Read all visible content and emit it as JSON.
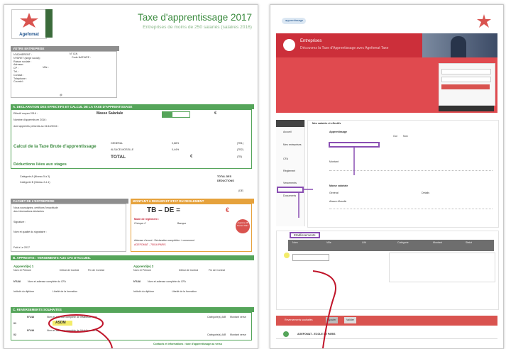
{
  "left": {
    "logo_text": "Agefomat",
    "title": "Taxe d'apprentissage 2017",
    "subtitle": "Entreprises de moins de 250 salariés (salaires 2016)",
    "sec_entreprise": "VOTRE ENTREPRISE",
    "sec_entreprise_fields": [
      "N°ADHERENT :",
      "N°SIRET (siège social) :",
      "Raison sociale :",
      "Adresse :",
      "CP :",
      "Tél. :",
      "Contact :",
      "Téléphone :",
      "Courriel :"
    ],
    "sec_entreprise_side": [
      "N° ICN",
      "Code NAF/APE :",
      "Ville :",
      "@"
    ],
    "sec_a": "A. DECLARATION DES EFFECTIFS ET CALCUL DE LA TAXE D'APPRENTISSAGE",
    "sec_a_lines": [
      "Effectif moyen 2016 :",
      "Nombre d'apprentis en 2016 :",
      "dont apprentis présents au 31/12/2016 :"
    ],
    "masse_label": "Masse Salariale",
    "taxe_brute_label": "Calcul de la Taxe Brute d'apprentissage",
    "taxe_rows": [
      "GENERAL",
      "ALSACE-MOSELLE"
    ],
    "taxe_rates": [
      "0,68%",
      "0,44%"
    ],
    "taxe_codes": [
      "(TB1)",
      "(TB2)",
      "(TB)"
    ],
    "total_label": "TOTAL",
    "euro": "€",
    "deductions_label": "Déductions liées aux stages",
    "deductions_lines": [
      "Catégorie A (Niveau 5 à 3)",
      "Catégorie B (Niveau 2 à 1)"
    ],
    "deductions_side": [
      "TOTAL DES",
      "DÉDUCTIONS"
    ],
    "deductions_code": "(DE)",
    "cachet_label": "CACHET DE L'ENTREPRISE",
    "cachet_lines": [
      "Nous soussignés, certifions l'exactitude",
      "des informations déclarées",
      "Signature :",
      "Nom et qualité du signataire :"
    ],
    "cachet_date": "Fait à          Le          2017",
    "montant_label": "MONTANT A REGLER ET ETAT DU REGLEMENT",
    "tb_de": "TB – DE =",
    "mode_label": "Mode de règlement :",
    "mode_opts": [
      "Chèque n°",
      "Banque"
    ],
    "stamp_text": "Avant le 28 février 2017",
    "address_lines": [
      "Adresse d'envoi : Déclaration complétée + versement",
      "AGEFOMAT - 75016 PARIS"
    ],
    "sec_b": "B. APPRENTIS : VERSEMENTS AUX CFA D'ACCUEIL",
    "b_heads": [
      "Apprenti(e) 1",
      "Apprenti(e) 2"
    ],
    "b_fields": [
      "Nom et Prénom",
      "Début de Contrat",
      "Fin de Contrat",
      "N°UAI",
      "Nom et adresse complète du CFA",
      "Intitulé du diplôme",
      "Libellé de la formation"
    ],
    "sec_c": "C. REVERSEMENTS SOUHAITES",
    "c_labels": [
      "N°UAI",
      "Nom et adresse complète de l'établissement",
      "Catégorie(s) A/B",
      "Montant verse"
    ],
    "c_row_ids": [
      "01",
      "02"
    ],
    "asdm": "ASDM",
    "footer": "Contacts et informations : taxe d'apprentissage au verso"
  },
  "right": {
    "logo_text": "apprentissage",
    "hero_title": "Entreprises",
    "hero_sub": "Découvrez la Taxe d'Apprentissage avec Agefomat Taxe",
    "menu_items": [
      "Accueil",
      "Mes entreprises",
      "CFA",
      "Règlement",
      "Versements",
      "Documents"
    ],
    "form_title": "Mes salariés et effectifs",
    "form_labels": [
      "Apprentissage",
      "Montant",
      "Masse salariale",
      "Général",
      "Alsace-Moselle",
      "Détails"
    ],
    "yes_no": [
      "Oui",
      "Non"
    ],
    "panel_title": "Etablissements",
    "table_heads": [
      "Nom",
      "Ville",
      "UAI",
      "Catégorie",
      "Montant",
      "Statut"
    ],
    "bottom_label": "Reversements souhaités",
    "bottom_row": "AGEFOMAT - ECOLE DE PARIS",
    "bottom_btns": [
      "Ajouter",
      "Valider"
    ]
  },
  "colors": {
    "green": "#55a55a",
    "red": "#d9534f",
    "orange": "#e6a23c",
    "annot": "#c0152a"
  }
}
